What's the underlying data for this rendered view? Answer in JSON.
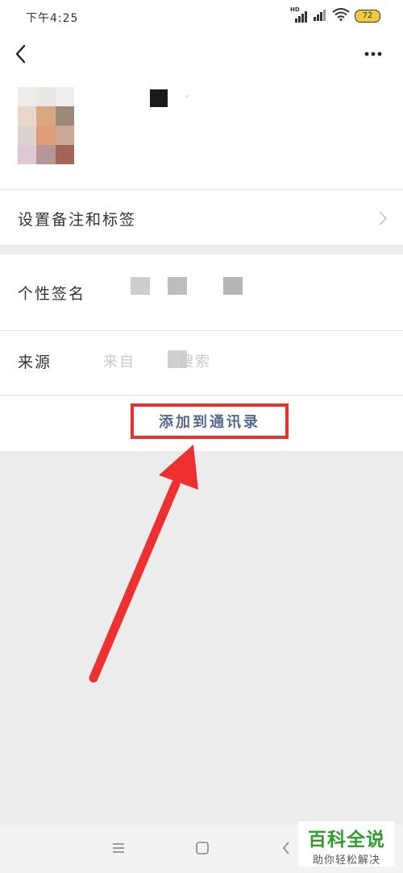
{
  "status_bar": {
    "time": "下午4:25",
    "battery": "72",
    "network_label": "HD"
  },
  "header": {
    "back_icon": "chevron-left-icon",
    "more_icon": "more-dots-icon"
  },
  "profile": {
    "avatar_colors": [
      "#f0ece9",
      "#ede7e4",
      "#eeeeee",
      "#e8d8cc",
      "#d9a781",
      "#9c8878",
      "#dcd3d0",
      "#df9e7a",
      "#caa797",
      "#dbcad6",
      "#b69697",
      "#a26658"
    ]
  },
  "rows": {
    "remark_label": "设置备注和标签",
    "signature_label": "个性签名",
    "source_label": "来源",
    "source_value_left": "来自",
    "source_value_right": "搜索"
  },
  "action": {
    "add_to_contacts": "添加到通讯录"
  },
  "annotation": {
    "arrow_color": "#ee3030",
    "box_color": "#e8312f"
  },
  "watermark": {
    "title": "百科全说",
    "subtitle": "助你轻松解决"
  }
}
